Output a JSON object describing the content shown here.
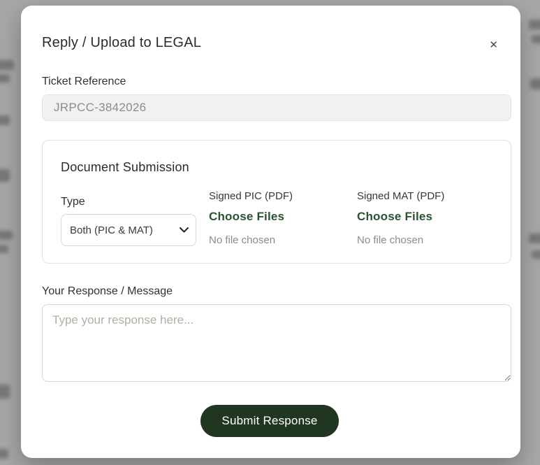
{
  "modal": {
    "title": "Reply / Upload to LEGAL",
    "close_icon": "✕",
    "ticket": {
      "label": "Ticket Reference",
      "value": "JRPCC-3842026"
    },
    "document_submission": {
      "title": "Document Submission",
      "type": {
        "label": "Type",
        "selected": "Both (PIC & MAT)"
      },
      "uploads": [
        {
          "label": "Signed PIC (PDF)",
          "button": "Choose Files",
          "status": "No file chosen"
        },
        {
          "label": "Signed MAT (PDF)",
          "button": "Choose Files",
          "status": "No file chosen"
        }
      ]
    },
    "response": {
      "label": "Your Response / Message",
      "placeholder": "Type your response here..."
    },
    "submit_label": "Submit Response"
  },
  "colors": {
    "overlay": "#a7a7a7",
    "accent_green": "#2b5231",
    "button_green": "#213621",
    "input_bg": "#f1f1f1",
    "card_border": "#e7e2d9"
  }
}
